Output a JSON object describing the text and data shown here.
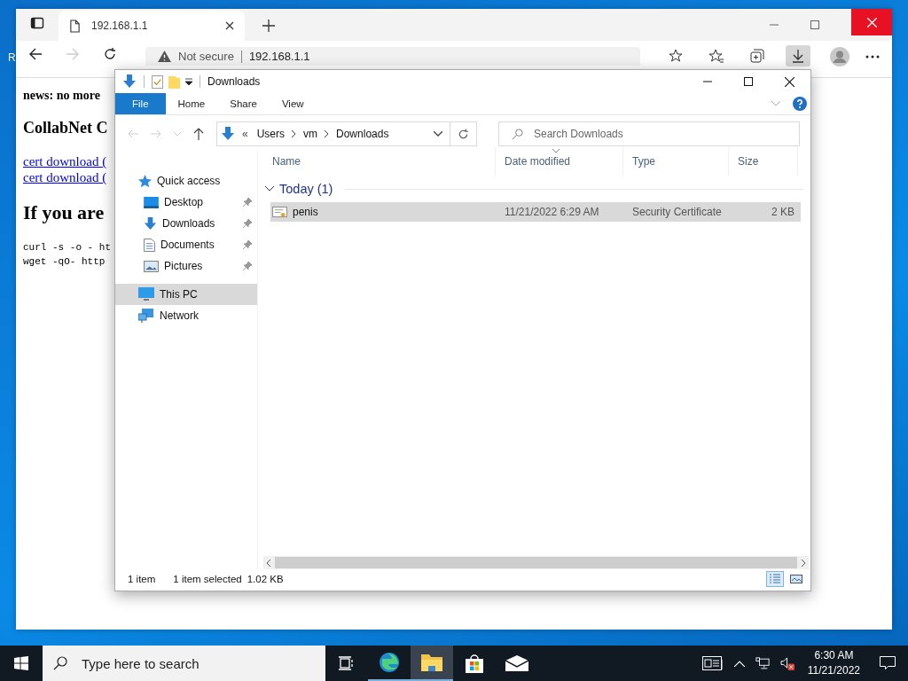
{
  "desktop": {
    "icon_labels": [
      "R"
    ]
  },
  "browser": {
    "tabs": [
      {
        "title": "192.168.1.1",
        "selected": true
      }
    ],
    "address": {
      "security": "Not secure",
      "url": "192.168.1.1"
    },
    "toolbar": [
      {
        "kind": "add-favorite",
        "selected": false
      },
      {
        "kind": "favorites",
        "selected": false
      },
      {
        "kind": "collections",
        "selected": false
      },
      {
        "kind": "downloads",
        "selected": true
      }
    ],
    "page": {
      "news": "news: no more",
      "heading": "CollabNet C",
      "links": [
        "cert download (",
        "cert download ("
      ],
      "heading2": "If you are",
      "code": [
        "curl -s -o - ht",
        "wget -qO- http"
      ]
    }
  },
  "explorer": {
    "title": "Downloads",
    "ribbon_tabs": [
      {
        "label": "File",
        "selected": true
      },
      {
        "label": "Home",
        "selected": false
      },
      {
        "label": "Share",
        "selected": false
      },
      {
        "label": "View",
        "selected": false
      }
    ],
    "overflow": "«",
    "breadcrumb": [
      "Users",
      "vm",
      "Downloads"
    ],
    "search": {
      "placeholder": "Search Downloads"
    },
    "nav": [
      {
        "label": "Quick access",
        "kind": "star",
        "selected": false,
        "children": [
          {
            "label": "Desktop",
            "kind": "desktop",
            "pinned": true,
            "selected": false
          },
          {
            "label": "Downloads",
            "kind": "download",
            "pinned": true,
            "selected": false
          },
          {
            "label": "Documents",
            "kind": "document",
            "pinned": true,
            "selected": false
          },
          {
            "label": "Pictures",
            "kind": "pictures",
            "pinned": true,
            "selected": false
          }
        ]
      },
      {
        "label": "This PC",
        "kind": "pc",
        "selected": true
      },
      {
        "label": "Network",
        "kind": "network",
        "selected": false
      }
    ],
    "columns": [
      {
        "label": "Name",
        "sorted": false
      },
      {
        "label": "Date modified",
        "sorted": true
      },
      {
        "label": "Type",
        "sorted": false
      },
      {
        "label": "Size",
        "sorted": false
      }
    ],
    "groups": [
      {
        "label": "Today (1)",
        "expanded": true,
        "rows": [
          {
            "name": "penis",
            "date": "11/21/2022 6:29 AM",
            "type": "Security Certificate",
            "size": "2 KB",
            "selected": true
          }
        ]
      }
    ],
    "status": {
      "count": "1 item",
      "selection": "1 item selected",
      "size": "1.02 KB"
    },
    "views": [
      {
        "kind": "details",
        "selected": true
      },
      {
        "kind": "tiles",
        "selected": false
      }
    ]
  },
  "taskbar": {
    "search_placeholder": "Type here to search",
    "apps": [
      {
        "kind": "task-view",
        "running": false,
        "active": false
      },
      {
        "kind": "edge",
        "running": true,
        "active": false
      },
      {
        "kind": "folder",
        "running": true,
        "active": true
      },
      {
        "kind": "store",
        "running": false,
        "active": false
      },
      {
        "kind": "mail",
        "running": false,
        "active": false
      }
    ],
    "time": "6:30 AM",
    "date": "11/21/2022"
  }
}
